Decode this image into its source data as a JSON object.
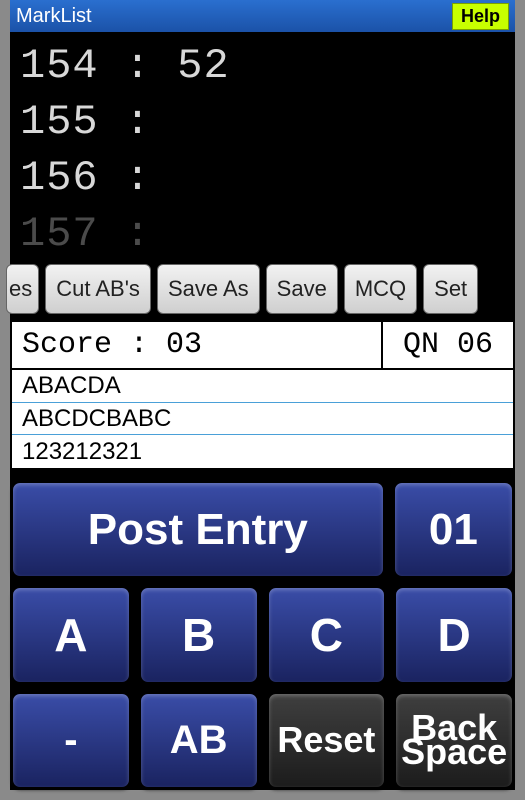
{
  "titlebar": {
    "title": "MarkList",
    "help": "Help"
  },
  "list": {
    "rows": [
      {
        "id": "154",
        "value": "52"
      },
      {
        "id": "155",
        "value": ""
      },
      {
        "id": "156",
        "value": ""
      },
      {
        "id": "157",
        "value": ""
      }
    ]
  },
  "toolbar": {
    "partial": "es",
    "cut_ab": "Cut AB's",
    "save_as": "Save As",
    "save": "Save",
    "mcq": "MCQ",
    "set": "Set"
  },
  "info": {
    "score_label": "Score : 03",
    "qn_label": "QN 06"
  },
  "entries": {
    "line1": "ABACDA",
    "line2": "ABCDCBABC",
    "line3": "123212321"
  },
  "keypad": {
    "post_entry": "Post Entry",
    "count": "01",
    "a": "A",
    "b": "B",
    "c": "C",
    "d": "D",
    "dash": "-",
    "ab": "AB",
    "reset": "Reset",
    "backspace_l1": "Back",
    "backspace_l2": "Space"
  }
}
